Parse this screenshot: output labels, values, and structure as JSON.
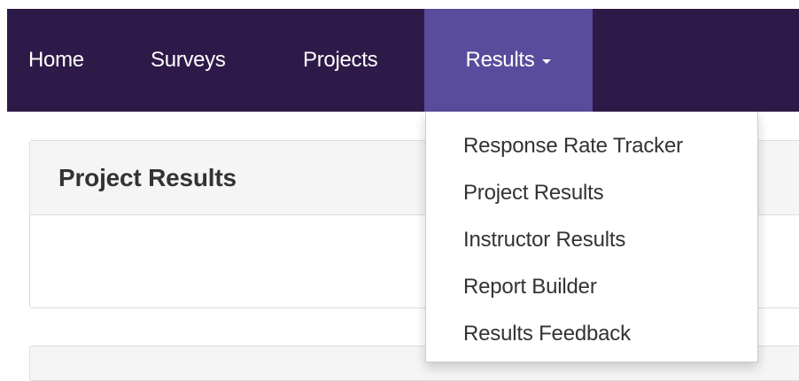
{
  "navbar": {
    "items": [
      {
        "label": "Home"
      },
      {
        "label": "Surveys"
      },
      {
        "label": "Projects"
      },
      {
        "label": "Results",
        "active": true,
        "icon": "caret-down-icon"
      }
    ],
    "background_color": "#2d1a48",
    "active_color": "#5a4c9c"
  },
  "panel": {
    "title": "Project Results"
  },
  "results_menu": {
    "items": [
      {
        "label": "Response Rate Tracker"
      },
      {
        "label": "Project Results"
      },
      {
        "label": "Instructor Results"
      },
      {
        "label": "Report Builder"
      },
      {
        "label": "Results Feedback"
      }
    ]
  }
}
